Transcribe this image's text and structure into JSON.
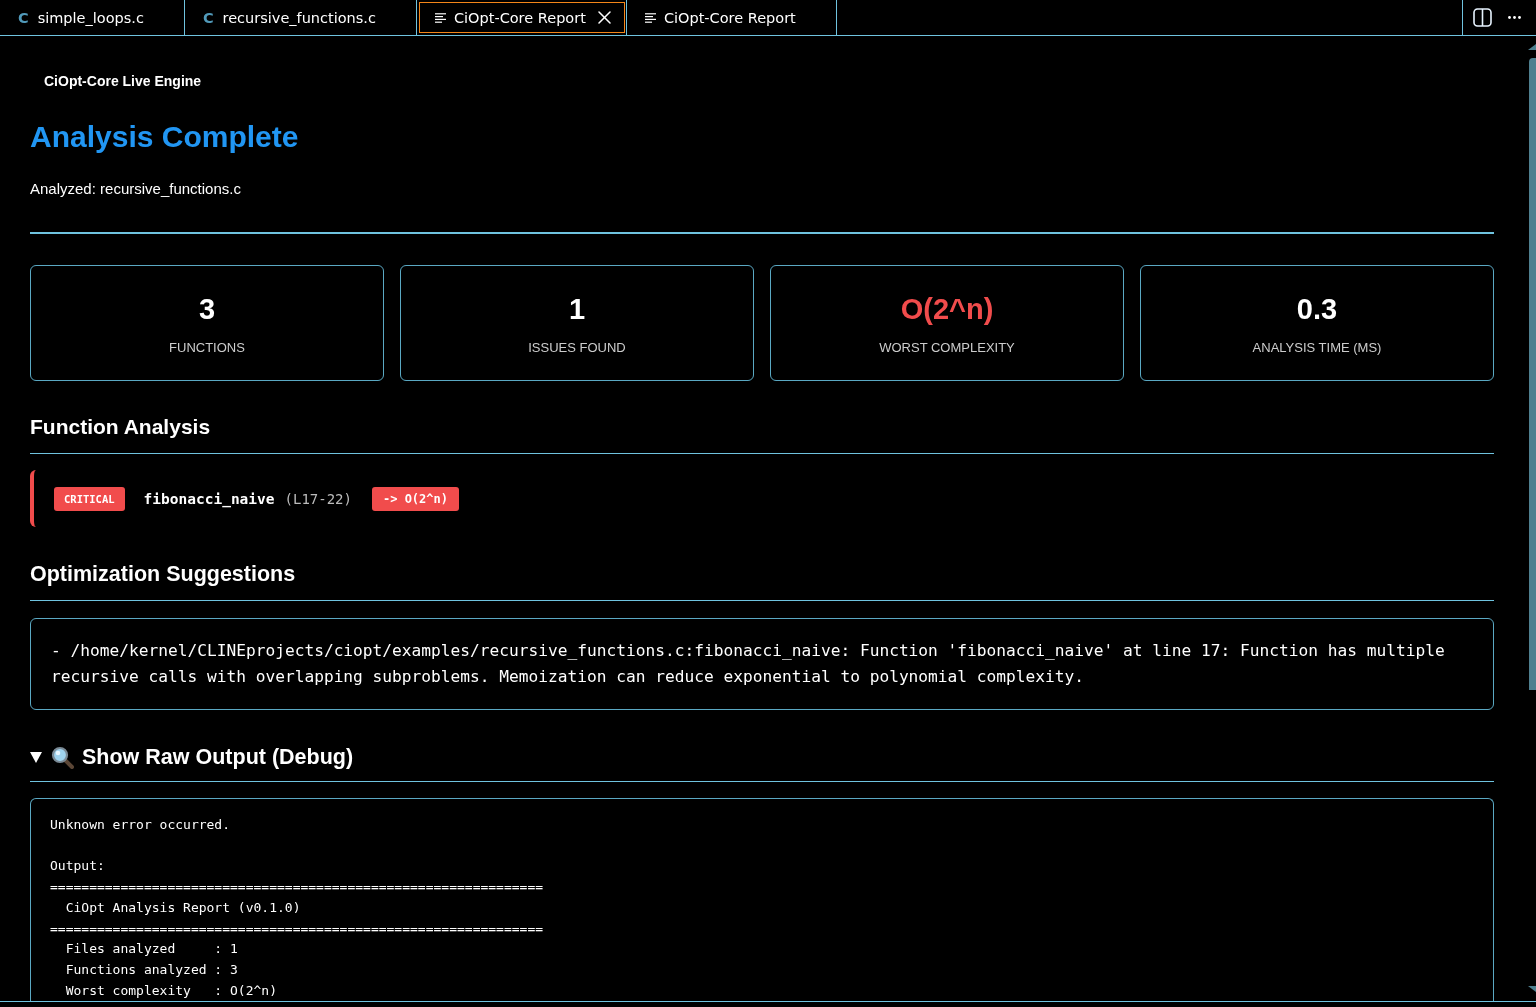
{
  "tabs": [
    {
      "kind": "c-file",
      "icon": "C",
      "label": "simple_loops.c",
      "selected": false
    },
    {
      "kind": "c-file",
      "icon": "C",
      "label": "recursive_functions.c",
      "selected": false
    },
    {
      "kind": "preview",
      "label": "CiOpt-Core Report",
      "selected": true
    },
    {
      "kind": "preview",
      "label": "CiOpt-Core Report",
      "selected": false
    }
  ],
  "report": {
    "brand": "CiOpt-Core Live Engine",
    "title": "Analysis Complete",
    "analyzed": "Analyzed: recursive_functions.c",
    "stats": [
      {
        "value": "3",
        "label": "FUNCTIONS",
        "color": "#ffffff"
      },
      {
        "value": "1",
        "label": "ISSUES FOUND",
        "color": "#ffffff"
      },
      {
        "value": "O(2^n)",
        "label": "WORST COMPLEXITY",
        "color": "#f14c4c"
      },
      {
        "value": "0.3",
        "label": "ANALYSIS TIME (MS)",
        "color": "#ffffff"
      }
    ],
    "function_analysis": {
      "heading": "Function Analysis",
      "functions": [
        {
          "color": "#f14c4c",
          "badge": "CRITICAL",
          "name": "fibonacci_naive",
          "lines": "(L17-22)",
          "complexity": "-> O(2^n)"
        }
      ]
    },
    "suggestions": {
      "heading": "Optimization Suggestions",
      "items": [
        "- /home/kernel/CLINEprojects/ciopt/examples/recursive_functions.c:fibonacci_naive: Function 'fibonacci_naive' at line 17: Function has multiple recursive calls with overlapping subproblems. Memoization can reduce exponential to polynomial complexity."
      ]
    },
    "raw_output": {
      "summary": "Show Raw Output (Debug)",
      "expanded": true,
      "text": "Unknown error occurred.\n\nOutput:\n===============================================================\n  CiOpt Analysis Report (v0.1.0)\n===============================================================\n  Files analyzed     : 1\n  Functions analyzed : 3\n  Worst complexity   : O(2^n)"
    }
  }
}
